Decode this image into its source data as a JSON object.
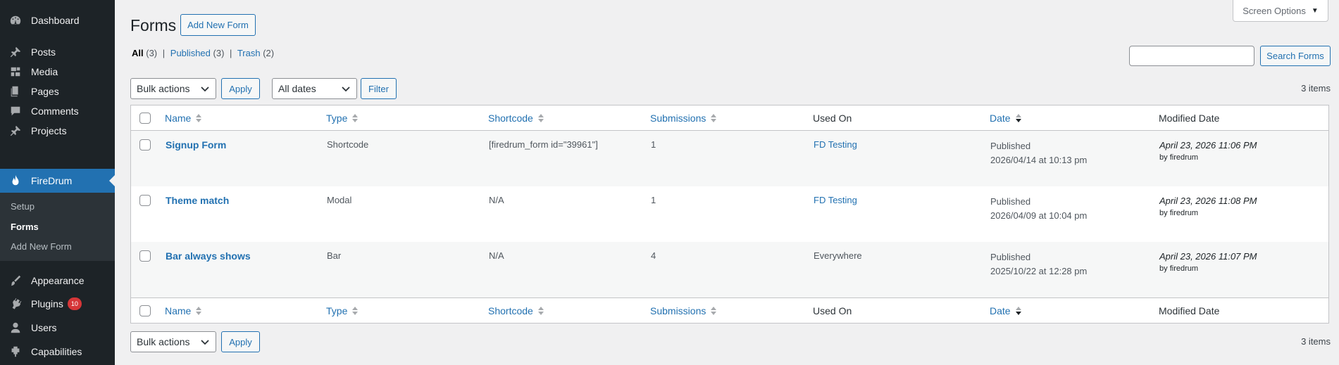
{
  "sidebar": {
    "items": [
      {
        "label": "Dashboard",
        "icon": "dashboard-icon"
      },
      {
        "label": "Posts",
        "icon": "pin-icon"
      },
      {
        "label": "Media",
        "icon": "media-icon"
      },
      {
        "label": "Pages",
        "icon": "pages-icon"
      },
      {
        "label": "Comments",
        "icon": "comment-icon"
      },
      {
        "label": "Projects",
        "icon": "pin-icon"
      },
      {
        "label": "FireDrum",
        "icon": "flame-icon"
      },
      {
        "label": "Appearance",
        "icon": "brush-icon"
      },
      {
        "label": "Plugins",
        "icon": "plugin-icon",
        "badge": "10"
      },
      {
        "label": "Users",
        "icon": "user-icon"
      },
      {
        "label": "Capabilities",
        "icon": "capabilities-icon"
      }
    ],
    "submenu": [
      {
        "label": "Setup"
      },
      {
        "label": "Forms"
      },
      {
        "label": "Add New Form"
      }
    ]
  },
  "header": {
    "title": "Forms",
    "add_new": "Add New Form",
    "screen_options": "Screen Options"
  },
  "views": {
    "all": "All",
    "all_count": "(3)",
    "published": "Published",
    "published_count": "(3)",
    "trash": "Trash",
    "trash_count": "(2)",
    "sep": "|"
  },
  "search": {
    "value": "",
    "button": "Search Forms"
  },
  "filters": {
    "bulk_actions": "Bulk actions",
    "apply": "Apply",
    "dates": "All dates",
    "filter": "Filter",
    "items_count": "3 items"
  },
  "table": {
    "columns": {
      "name": "Name",
      "type": "Type",
      "shortcode": "Shortcode",
      "submissions": "Submissions",
      "used_on": "Used On",
      "date": "Date",
      "modified": "Modified Date"
    },
    "rows": [
      {
        "name": "Signup Form",
        "type": "Shortcode",
        "shortcode": "[firedrum_form id=\"39961\"]",
        "submissions": "1",
        "used_on": "FD Testing",
        "status": "Published",
        "date": "2026/04/14 at 10:13 pm",
        "modified": "April 23, 2026 11:06 PM",
        "by_label": "by",
        "by": "firedrum"
      },
      {
        "name": "Theme match",
        "type": "Modal",
        "shortcode": "N/A",
        "submissions": "1",
        "used_on": "FD Testing",
        "status": "Published",
        "date": "2026/04/09 at 10:04 pm",
        "modified": "April 23, 2026 11:08 PM",
        "by_label": "by",
        "by": "firedrum"
      },
      {
        "name": "Bar always shows",
        "type": "Bar",
        "shortcode": "N/A",
        "submissions": "4",
        "used_on": "Everywhere",
        "status": "Published",
        "date": "2025/10/22 at 12:28 pm",
        "modified": "April 23, 2026 11:07 PM",
        "by_label": "by",
        "by": "firedrum"
      }
    ]
  },
  "colors": {
    "sidebar_bg": "#1d2327",
    "accent": "#2271b1",
    "badge": "#d63638"
  }
}
